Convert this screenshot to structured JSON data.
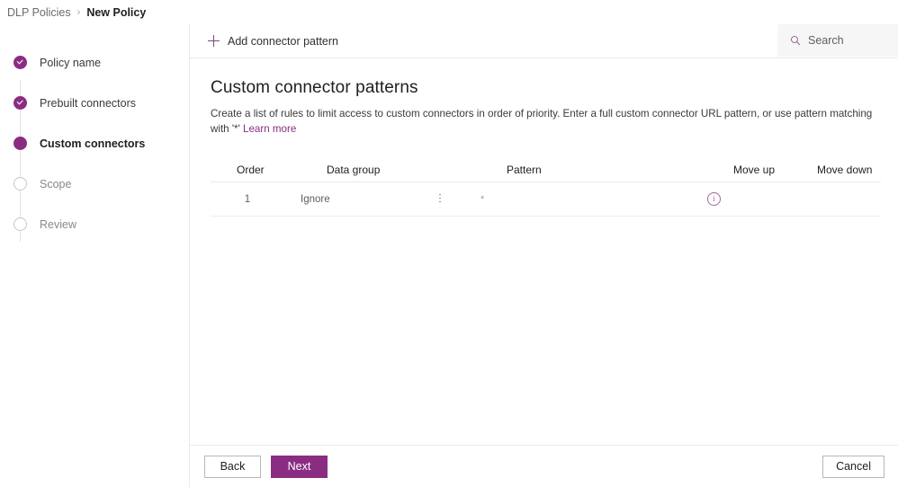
{
  "breadcrumb": {
    "parent": "DLP Policies",
    "separator": "›",
    "current": "New Policy"
  },
  "wizard": {
    "steps": [
      {
        "label": "Policy name",
        "state": "done",
        "icon": "check-circle-icon"
      },
      {
        "label": "Prebuilt connectors",
        "state": "done",
        "icon": "check-circle-icon"
      },
      {
        "label": "Custom connectors",
        "state": "current",
        "icon": "filled-circle-icon"
      },
      {
        "label": "Scope",
        "state": "todo",
        "icon": "empty-circle-icon"
      },
      {
        "label": "Review",
        "state": "todo",
        "icon": "empty-circle-icon"
      }
    ]
  },
  "commandbar": {
    "add_label": "Add connector pattern",
    "add_icon": "plus-icon",
    "search_placeholder": "Search",
    "search_value": "",
    "search_icon": "search-icon"
  },
  "main": {
    "title": "Custom connector patterns",
    "description_part1": "Create a list of rules to limit access to custom connectors in order of priority. Enter a full custom connector URL pattern, or use pattern matching with '*' ",
    "description_link": "Learn more"
  },
  "table": {
    "columns": {
      "order": "Order",
      "data_group": "Data group",
      "pattern": "Pattern",
      "move_up": "Move up",
      "move_down": "Move down"
    },
    "rows": [
      {
        "order": "1",
        "data_group": "Ignore",
        "group_menu_icon": "more-vertical-icon",
        "pattern": "*",
        "move_up_icon": "info-circle-icon",
        "move_down_icon": ""
      }
    ]
  },
  "footer": {
    "back_label": "Back",
    "next_label": "Next",
    "cancel_label": "Cancel"
  },
  "colors": {
    "accent": "#8a2d82",
    "link": "#8a2d82",
    "border": "#edebe9",
    "search_background": "#f6f6f6"
  }
}
